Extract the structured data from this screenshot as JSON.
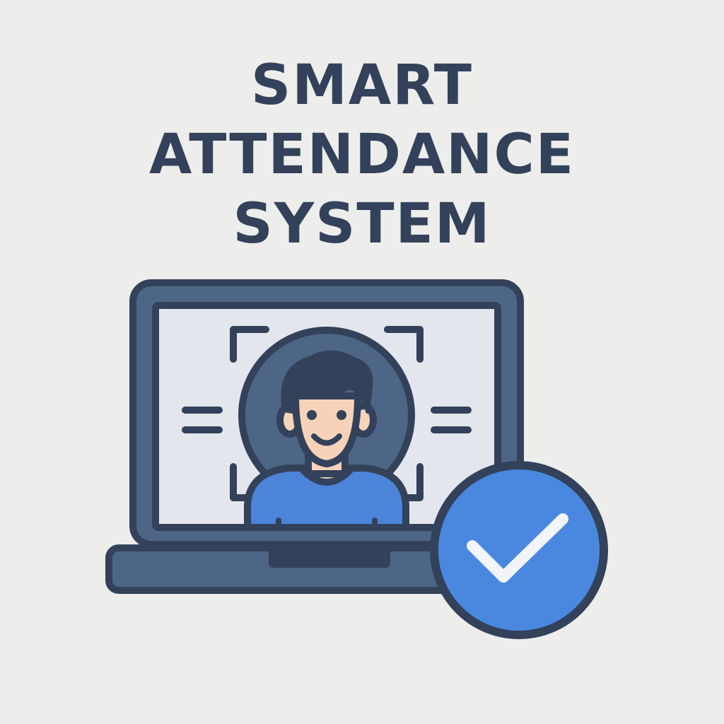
{
  "title": {
    "line1": "SMART",
    "line2": "ATTENDANCE",
    "line3": "SYSTEM"
  },
  "colors": {
    "background": "#ededeb",
    "outline": "#33425a",
    "laptop_body": "#4d6685",
    "screen": "#e3e7ed",
    "avatar_circle": "#4d6685",
    "shirt": "#4b84d8",
    "skin": "#f6d3b8",
    "check_circle": "#4a88e0",
    "check_mark": "#f2f4f8"
  },
  "icons": {
    "laptop": "laptop-icon",
    "user": "user-avatar-icon",
    "face_scan": "face-scan-frame-icon",
    "check": "check-badge-icon"
  }
}
